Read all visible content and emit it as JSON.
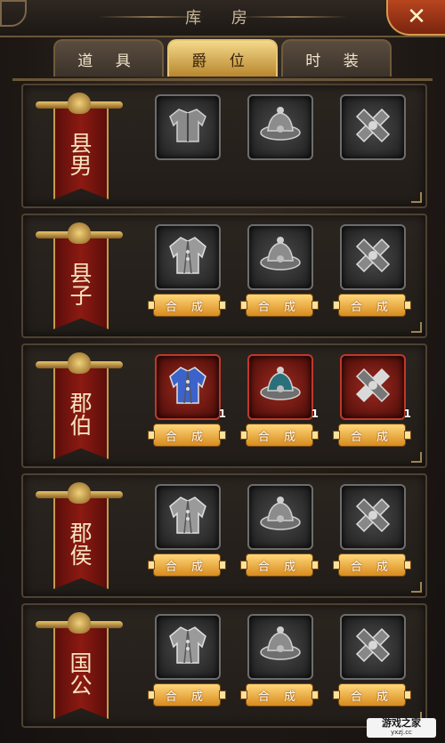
{
  "title": "库 房",
  "close_icon": "close-x-icon",
  "tabs": [
    {
      "label": "道 具",
      "active": false
    },
    {
      "label": "爵 位",
      "active": true
    },
    {
      "label": "时 装",
      "active": false
    }
  ],
  "combine_label": "合 成",
  "ranks": [
    {
      "name": "县男",
      "items": [
        {
          "icon": "armor-icon",
          "count": "",
          "button": false,
          "owned": false
        },
        {
          "icon": "hat-icon",
          "count": "",
          "button": false,
          "owned": false
        },
        {
          "icon": "belt-icon",
          "count": "",
          "button": false,
          "owned": false
        }
      ]
    },
    {
      "name": "县子",
      "items": [
        {
          "icon": "robe-icon",
          "count": "",
          "button": true,
          "owned": false
        },
        {
          "icon": "hat-icon",
          "count": "",
          "button": true,
          "owned": false
        },
        {
          "icon": "belt-icon",
          "count": "",
          "button": true,
          "owned": false
        }
      ]
    },
    {
      "name": "郡伯",
      "items": [
        {
          "icon": "robe-icon",
          "count": "1",
          "button": true,
          "owned": true
        },
        {
          "icon": "hat-icon",
          "count": "1",
          "button": true,
          "owned": true
        },
        {
          "icon": "belt-icon",
          "count": "1",
          "button": true,
          "owned": true
        }
      ]
    },
    {
      "name": "郡侯",
      "items": [
        {
          "icon": "robe-icon",
          "count": "",
          "button": true,
          "owned": false
        },
        {
          "icon": "hat-icon",
          "count": "",
          "button": true,
          "owned": false
        },
        {
          "icon": "belt-icon",
          "count": "",
          "button": true,
          "owned": false
        }
      ]
    },
    {
      "name": "国公",
      "items": [
        {
          "icon": "robe-icon",
          "count": "",
          "button": true,
          "owned": false
        },
        {
          "icon": "hat-icon",
          "count": "",
          "button": true,
          "owned": false
        },
        {
          "icon": "belt-icon",
          "count": "",
          "button": true,
          "owned": false
        }
      ]
    }
  ],
  "watermark": {
    "text": "游戏之家",
    "sub": "yxzj.cc"
  },
  "colors": {
    "accent": "#e7c673",
    "banner": "#8c1a12",
    "button": "#d88b1e",
    "owned_border": "#c0382a"
  }
}
